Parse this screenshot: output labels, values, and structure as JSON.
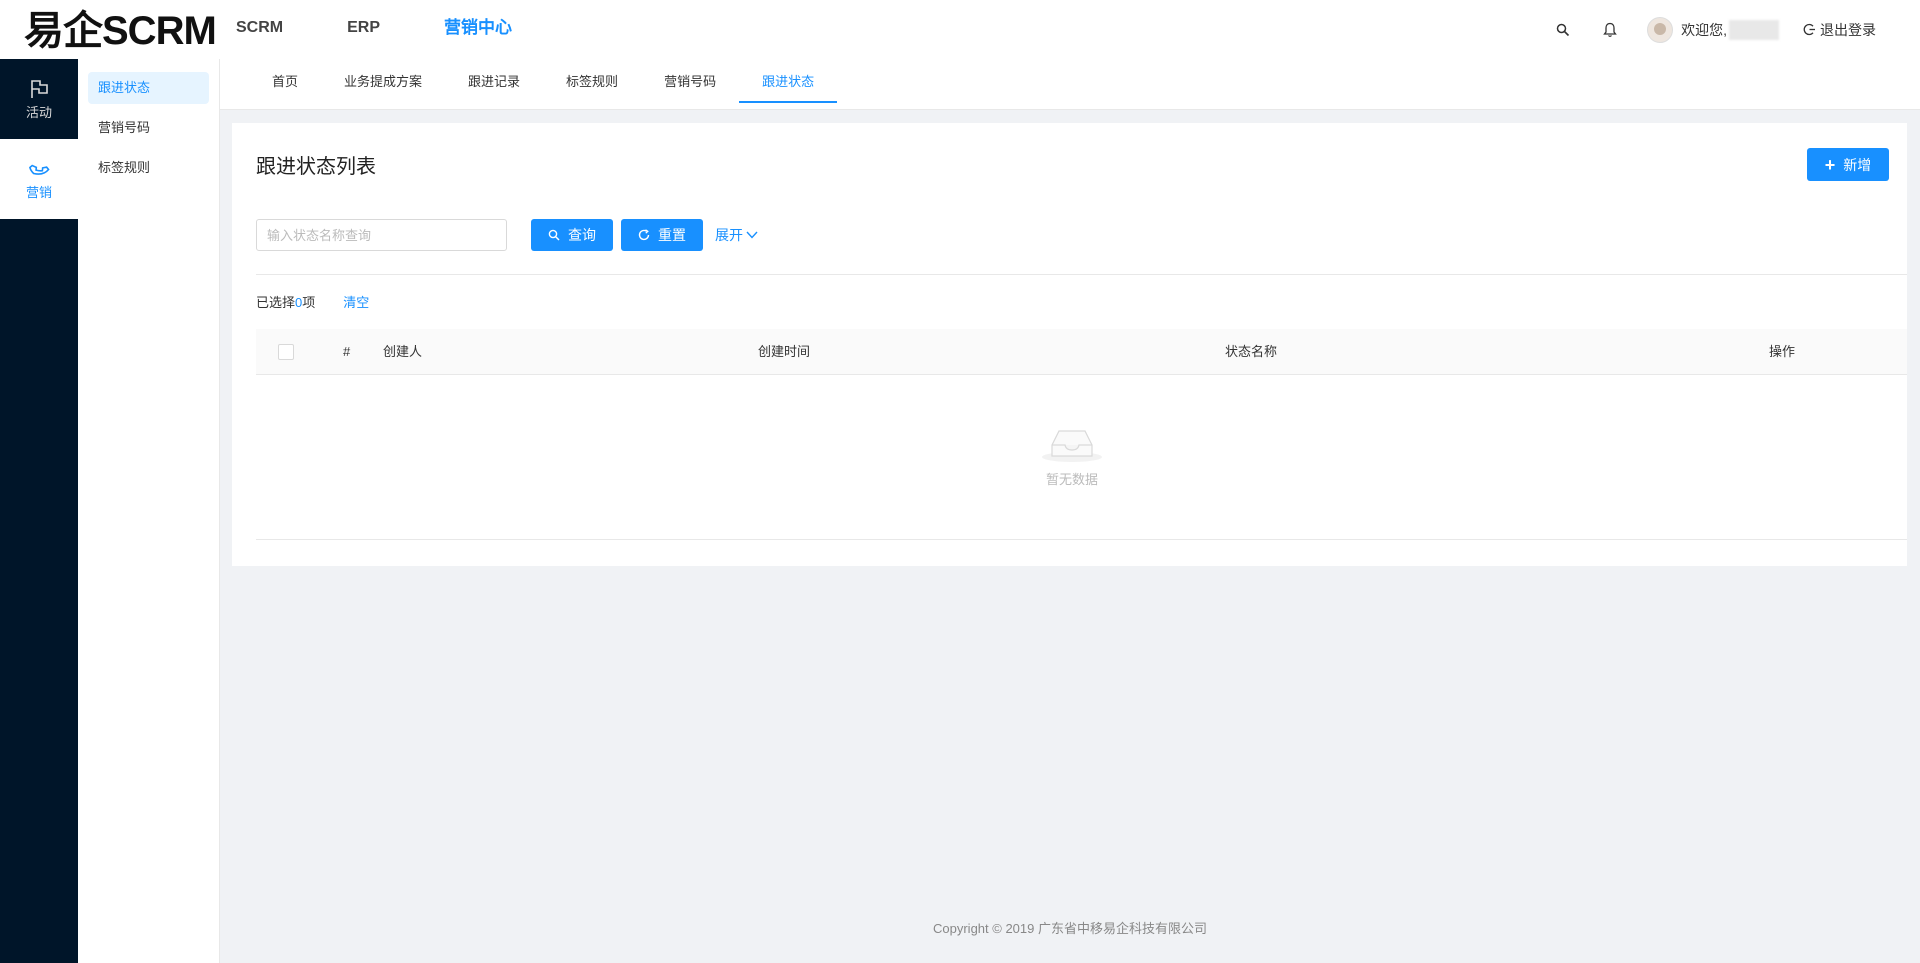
{
  "app": {
    "logo": "易企SCRM"
  },
  "topnav": [
    {
      "label": "SCRM",
      "active": false
    },
    {
      "label": "ERP",
      "active": false
    },
    {
      "label": "营销中心",
      "active": true
    }
  ],
  "header": {
    "welcome": "欢迎您,",
    "logout": "退出登录"
  },
  "iconbar": [
    {
      "label": "活动",
      "icon": "flag-icon",
      "active": false
    },
    {
      "label": "营销",
      "icon": "phone-icon",
      "active": true
    }
  ],
  "submenu": [
    {
      "label": "跟进状态",
      "active": true
    },
    {
      "label": "营销号码",
      "active": false
    },
    {
      "label": "标签规则",
      "active": false
    }
  ],
  "tabs": [
    {
      "label": "首页",
      "active": false
    },
    {
      "label": "业务提成方案",
      "active": false
    },
    {
      "label": "跟进记录",
      "active": false
    },
    {
      "label": "标签规则",
      "active": false
    },
    {
      "label": "营销号码",
      "active": false
    },
    {
      "label": "跟进状态",
      "active": true
    }
  ],
  "page": {
    "title": "跟进状态列表",
    "add_label": "新增",
    "search_placeholder": "输入状态名称查询",
    "query_label": "查询",
    "reset_label": "重置",
    "expand_label": "展开",
    "selected_prefix": "已选择",
    "selected_count": "0",
    "selected_suffix": "项",
    "clear_label": "清空"
  },
  "table": {
    "columns": [
      "#",
      "创建人",
      "创建时间",
      "状态名称",
      "操作"
    ],
    "rows": [],
    "empty_text": "暂无数据"
  },
  "footer": {
    "copyright": "Copyright © 2019 广东省中移易企科技有限公司"
  },
  "colors": {
    "primary": "#1890ff",
    "sidebar": "#001529",
    "background": "#f0f2f5"
  }
}
